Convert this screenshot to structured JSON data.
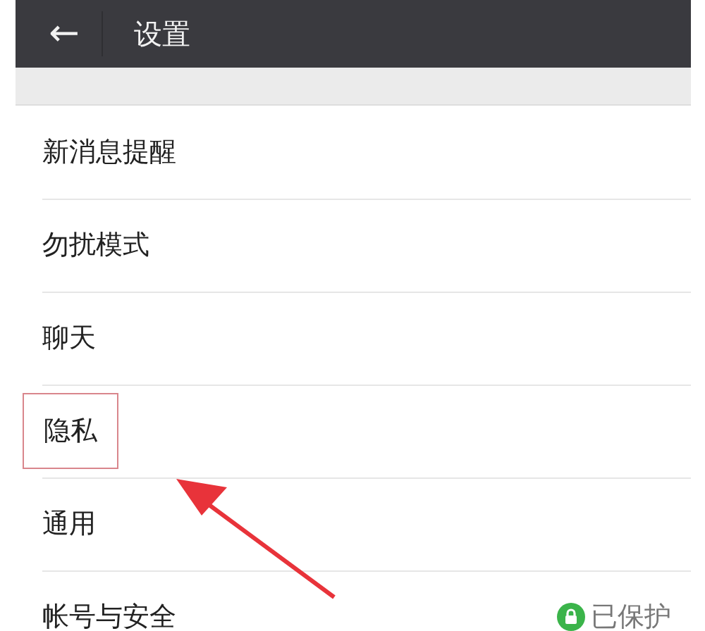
{
  "header": {
    "back_icon": "←",
    "title": "设置"
  },
  "items": [
    {
      "label": "新消息提醒",
      "highlighted": false
    },
    {
      "label": "勿扰模式",
      "highlighted": false
    },
    {
      "label": "聊天",
      "highlighted": false
    },
    {
      "label": "隐私",
      "highlighted": true
    },
    {
      "label": "通用",
      "highlighted": false
    },
    {
      "label": "帐号与安全",
      "highlighted": false,
      "status": "已保护"
    }
  ]
}
